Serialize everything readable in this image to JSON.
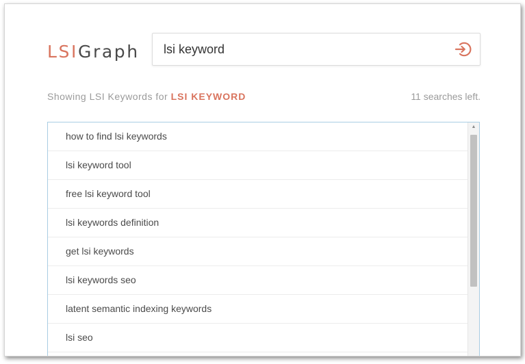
{
  "logo": {
    "part1": "LSI",
    "part2": "Graph"
  },
  "search": {
    "value": "lsi keyword",
    "button_icon": "sign-in-arrow-circle-icon"
  },
  "status": {
    "showing_prefix": "Showing LSI Keywords for",
    "keyword": "LSI KEYWORD",
    "searches_left": "11 searches left."
  },
  "results": [
    "how to find lsi keywords",
    "lsi keyword tool",
    "free lsi keyword tool",
    "lsi keywords definition",
    "get lsi keywords",
    "lsi keywords seo",
    "latent semantic indexing keywords",
    "lsi seo"
  ],
  "colors": {
    "accent": "#d9745e",
    "list_border": "#a9cde3",
    "muted_text": "#9a9a9a"
  }
}
